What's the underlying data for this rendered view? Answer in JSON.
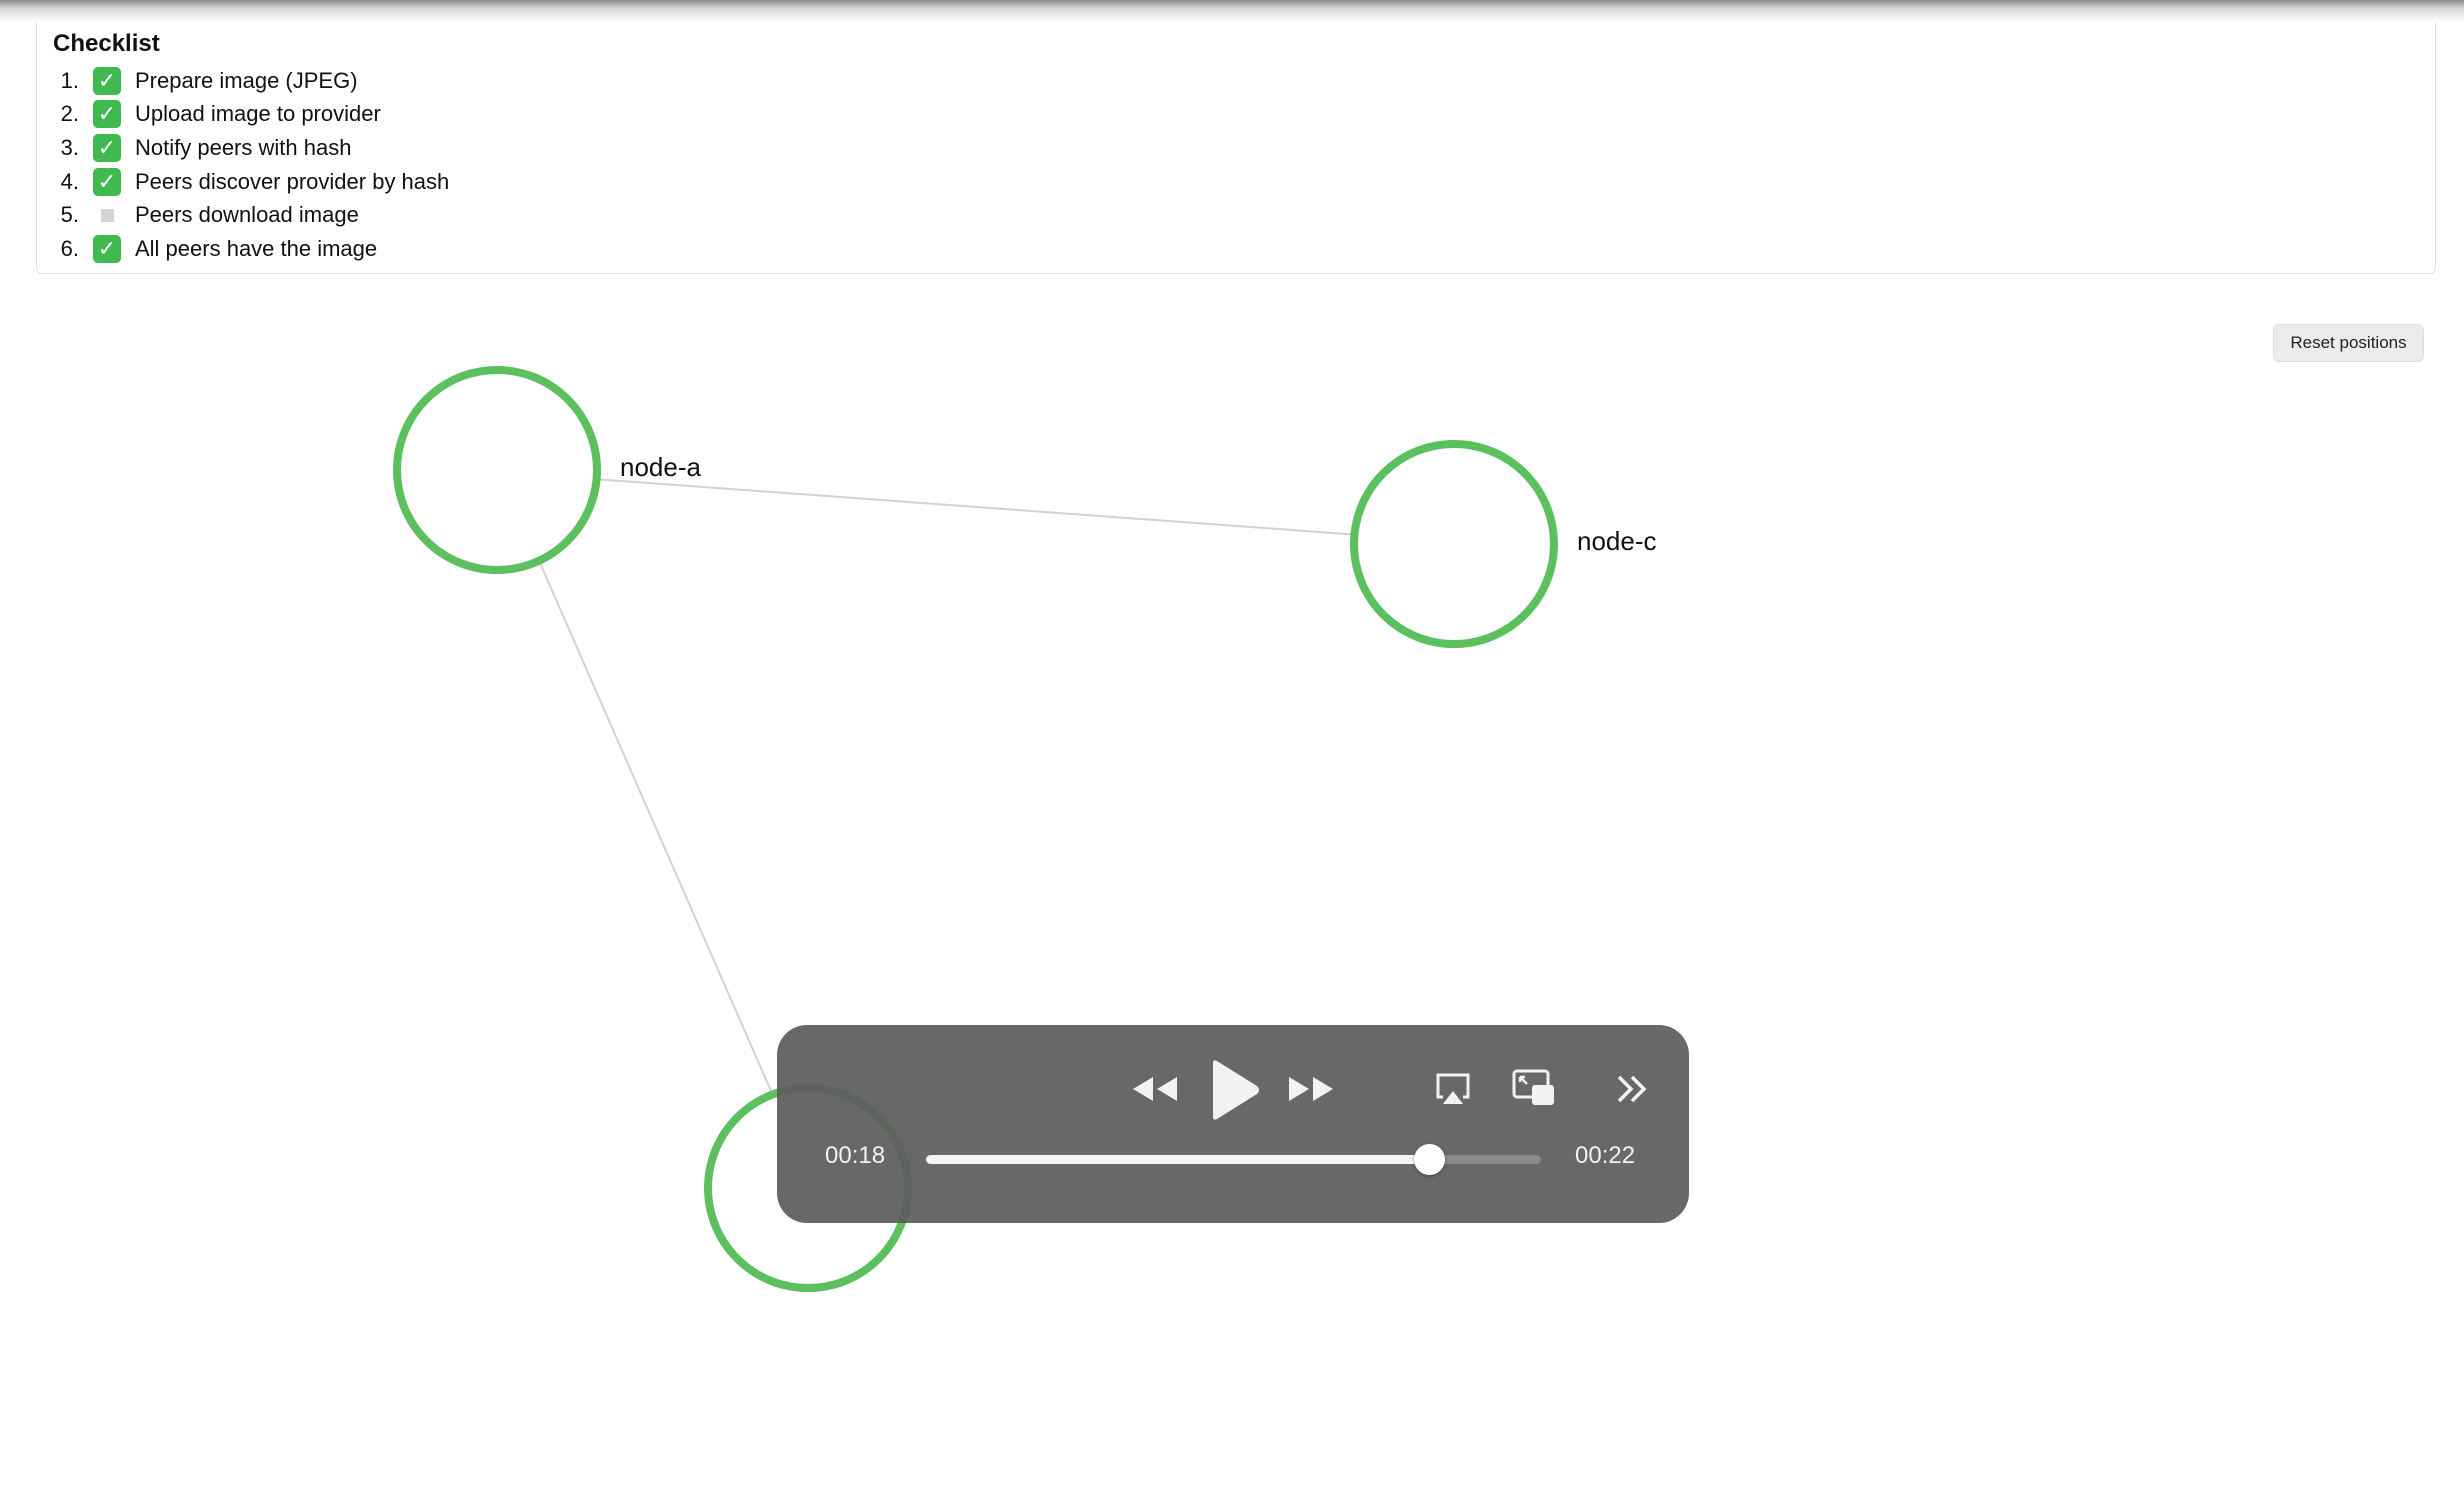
{
  "checklist": {
    "title": "Checklist",
    "items": [
      {
        "num": "1.",
        "label": "Prepare image (JPEG)",
        "done": true
      },
      {
        "num": "2.",
        "label": "Upload image to provider",
        "done": true
      },
      {
        "num": "3.",
        "label": "Notify peers with hash",
        "done": true
      },
      {
        "num": "4.",
        "label": "Peers discover provider by hash",
        "done": true
      },
      {
        "num": "5.",
        "label": "Peers download image",
        "done": false
      },
      {
        "num": "6.",
        "label": "All peers have the image",
        "done": true
      }
    ],
    "check_glyph": "✓"
  },
  "reset_button": {
    "label": "Reset positions"
  },
  "graph": {
    "nodes": [
      {
        "id": "node-a",
        "label": "node-a",
        "ring_color": "#5cc05f"
      },
      {
        "id": "node-c",
        "label": "node-c",
        "ring_color": "#5cc05f"
      },
      {
        "id": "node-b",
        "label": "",
        "ring_color": "#5cc05f"
      }
    ],
    "edges": [
      [
        "node-a",
        "node-c"
      ],
      [
        "node-a",
        "node-b"
      ]
    ]
  },
  "player": {
    "current_time": "00:18",
    "duration": "00:22",
    "progress": 0.818,
    "icons": [
      "rewind-icon",
      "play-icon",
      "fast-forward-icon",
      "airplay-icon",
      "picture-in-picture-icon",
      "more-controls-icon"
    ]
  }
}
